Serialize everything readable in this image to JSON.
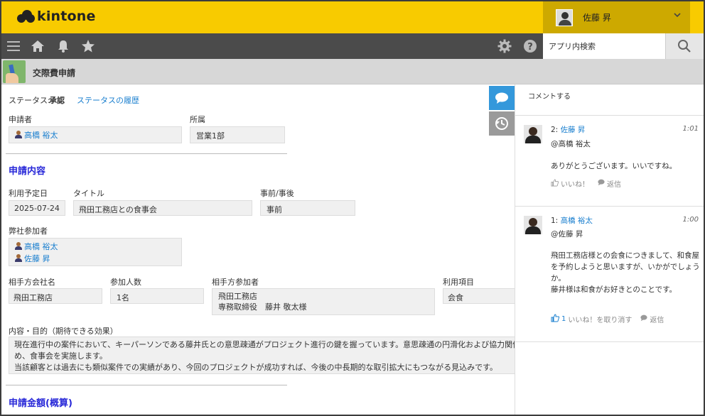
{
  "header": {
    "logo_text": "kintone",
    "user_name": "佐藤 昇",
    "brand_color": "#f8cb00"
  },
  "toolbar": {
    "icons": [
      "menu-icon",
      "home-icon",
      "bell-icon",
      "star-icon",
      "gear-icon",
      "help-icon",
      "search-icon"
    ],
    "search_placeholder": "アプリ内検索"
  },
  "app": {
    "title": "交際費申請"
  },
  "record": {
    "status_label": "ステータス:",
    "status_value": "承認",
    "status_history_link": "ステータスの履歴",
    "applicant_label": "申請者",
    "applicant_value": "高橋 裕太",
    "dept_label": "所属",
    "dept_value": "営業1部",
    "section1_title": "申請内容",
    "date_label": "利用予定日",
    "date_value": "2025-07-24",
    "title_label": "タイトル",
    "title_value": "飛田工務店との食事会",
    "timing_label": "事前/事後",
    "timing_value": "事前",
    "attendees_label": "弊社参加者",
    "attendees": [
      "高橋 裕太",
      "佐藤 昇"
    ],
    "company_label": "相手方会社名",
    "company_value": "飛田工務店",
    "count_label": "参加人数",
    "count_value": "1名",
    "partner_label": "相手方参加者",
    "partner_line1": "飛田工務店",
    "partner_line2": "専務取締役　藤井 敬太様",
    "item_label": "利用項目",
    "item_value": "会食",
    "purpose_label": "内容・目的（期待できる効果）",
    "purpose_line1": "現在進行中の案件において、キーパーソンである藤井氏との意思疎通がプロジェクト進行の鍵を握っています。意思疎通の円滑化および協力関係の維持の",
    "purpose_line2": "め、食事会を実施します。",
    "purpose_line3": "当該顧客とは過去にも類似案件での実績があり、今回のプロジェクトが成功すれば、今後の中長期的な取引拡大にもつながる見込みです。",
    "section2_title": "申請金額(概算)"
  },
  "comments": {
    "post_label": "コメントする",
    "items": [
      {
        "number": "2:",
        "author": "佐藤 昇",
        "time": "1:01",
        "mention": "@高橋 裕太",
        "lines": [
          "ありがとうございます。いいですね。"
        ],
        "like_count": "",
        "like_label": "いいね！",
        "reply_label": "返信"
      },
      {
        "number": "1:",
        "author": "高橋 裕太",
        "time": "1:00",
        "mention": "@佐藤 昇",
        "lines": [
          "飛田工務店様との会食につきまして、和食屋",
          "を予約しようと思いますが、いかがでしょう",
          "か。",
          "藤井様は和食がお好きとのことです。"
        ],
        "like_count": "1",
        "like_label": "いいね！を取り消す",
        "reply_label": "返信"
      }
    ]
  }
}
